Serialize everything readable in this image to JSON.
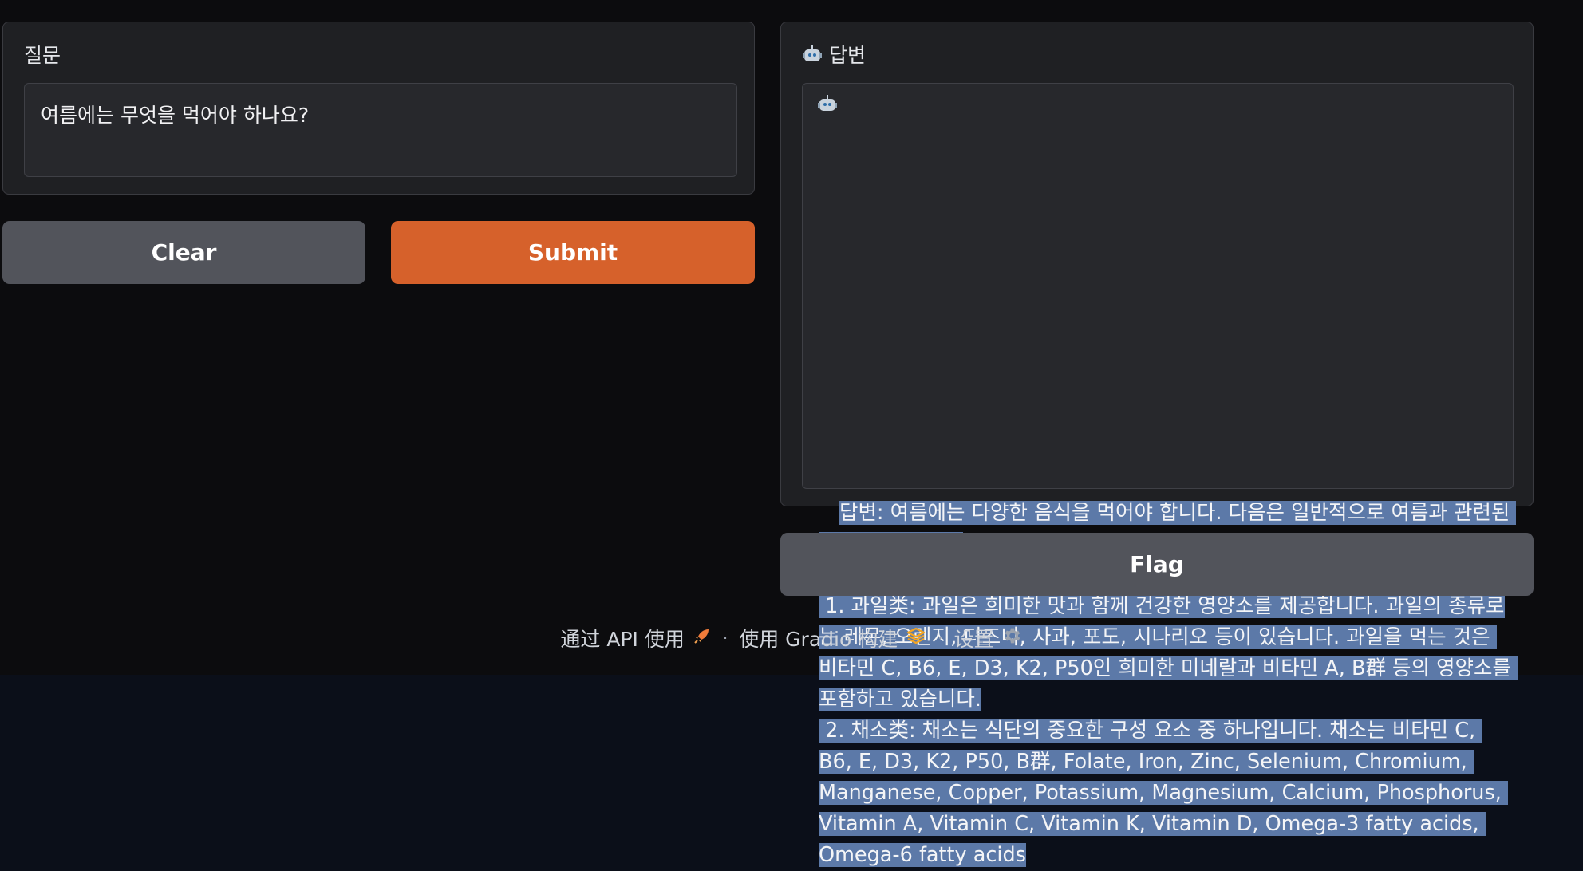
{
  "question": {
    "label": "질문",
    "value": "여름에는 무엇을 먹어야 하나요?"
  },
  "buttons": {
    "clear": "Clear",
    "submit": "Submit",
    "flag": "Flag"
  },
  "answer": {
    "label": "답변",
    "icon": "robot-icon",
    "paragraphs": [
      "답변: 여름에는 다양한 음식을 먹어야 합니다. 다음은 일반적으로 여름과 관련된 음식 목록입니다:",
      "",
      " 1. 과일类: 과일은 희미한 맛과 함께 건강한 영양소를 제공합니다. 과일의 종류로는 레몬, 오렌지, 디즈니, 사과, 포도, 시나리오 등이 있습니다. 과일을 먹는 것은 비타민 C, B6, E, D3, K2, P50인 희미한 미네랄과 비타민 A, B群 등의 영양소를 포함하고 있습니다.",
      " 2. 채소类: 채소는 식단의 중요한 구성 요소 중 하나입니다. 채소는 비타민 C, B6, E, D3, K2, P50, B群, Folate, Iron, Zinc, Selenium, Chromium, Manganese, Copper, Potassium, Magnesium, Calcium, Phosphorus, Vitamin A, Vitamin C, Vitamin K, Vitamin D, Omega-3 fatty acids, Omega-6 fatty acids"
    ]
  },
  "footer": {
    "api": "通过 API 使用",
    "api_icon": "rocket-icon",
    "built": "使用 Gradio 构建",
    "built_icon": "gradio-logo-icon",
    "settings": "设置",
    "settings_icon": "gear-icon",
    "separator": "·"
  },
  "colors": {
    "primary": "#d6612b",
    "secondary": "#52545b",
    "selection": "#5c79a8",
    "panel": "#1f2023",
    "background": "#0c0c0e"
  }
}
